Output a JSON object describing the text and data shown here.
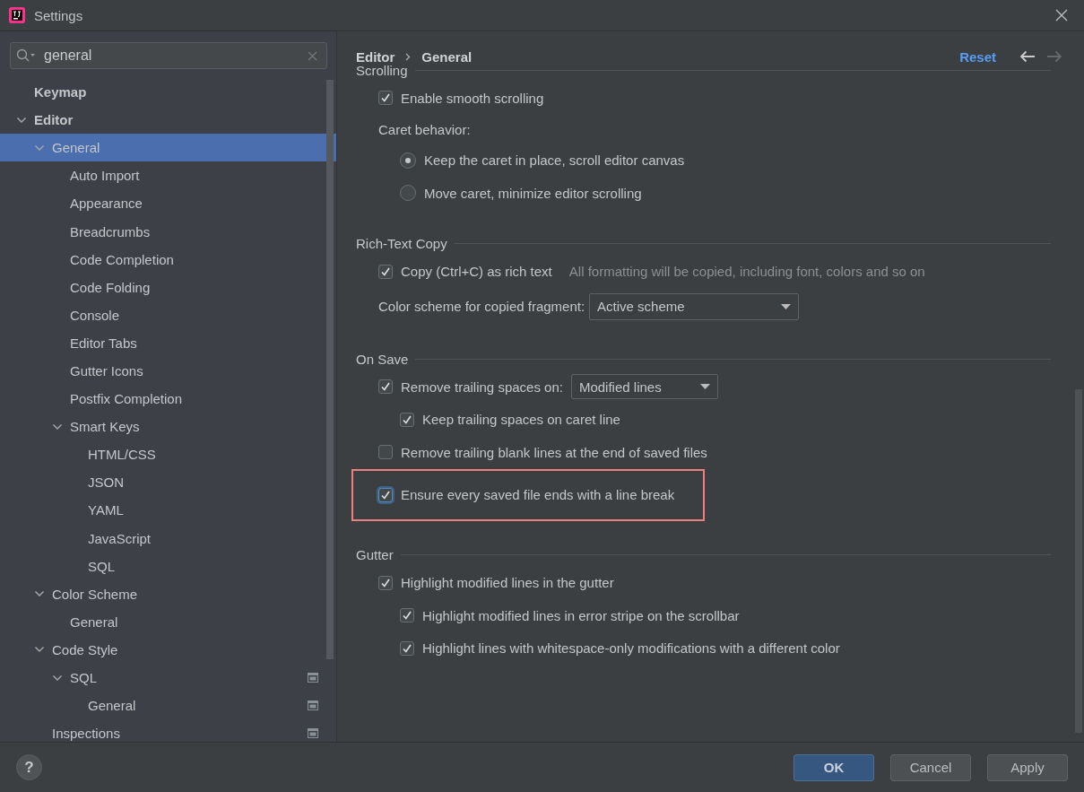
{
  "window": {
    "title": "Settings"
  },
  "search": {
    "value": "general"
  },
  "tree": [
    {
      "label": "Keymap",
      "selected": false
    },
    {
      "label": "Editor",
      "selected": false,
      "expanded": true,
      "children": [
        {
          "label": "General",
          "selected": true,
          "expanded": true,
          "children": [
            {
              "label": "Auto Import",
              "selected": false
            },
            {
              "label": "Appearance",
              "selected": false
            },
            {
              "label": "Breadcrumbs",
              "selected": false
            },
            {
              "label": "Code Completion",
              "selected": false
            },
            {
              "label": "Code Folding",
              "selected": false
            },
            {
              "label": "Console",
              "selected": false
            },
            {
              "label": "Editor Tabs",
              "selected": false
            },
            {
              "label": "Gutter Icons",
              "selected": false
            },
            {
              "label": "Postfix Completion",
              "selected": false
            },
            {
              "label": "Smart Keys",
              "selected": false,
              "expanded": true,
              "children": [
                {
                  "label": "HTML/CSS",
                  "selected": false
                },
                {
                  "label": "JSON",
                  "selected": false
                },
                {
                  "label": "YAML",
                  "selected": false
                },
                {
                  "label": "JavaScript",
                  "selected": false
                },
                {
                  "label": "SQL",
                  "selected": false
                }
              ]
            }
          ]
        },
        {
          "label": "Color Scheme",
          "selected": false,
          "expanded": true,
          "children": [
            {
              "label": "General",
              "selected": false
            }
          ]
        },
        {
          "label": "Code Style",
          "selected": false,
          "expanded": true,
          "children": [
            {
              "label": "SQL",
              "selected": false,
              "project_level": true,
              "expanded": true,
              "children": [
                {
                  "label": "General",
                  "selected": false,
                  "project_level": true
                }
              ]
            }
          ]
        },
        {
          "label": "Inspections",
          "selected": false,
          "project_level": true
        }
      ]
    }
  ],
  "breadcrumb": [
    "Editor",
    "General"
  ],
  "reset": "Reset",
  "forward_enabled": false,
  "sections": [
    {
      "title": "Scrolling",
      "items": [
        {
          "kind": "checkbox",
          "label": "Enable smooth scrolling",
          "checked": true
        },
        {
          "kind": "radio-group",
          "label": "Caret behavior:",
          "options": [
            {
              "label": "Keep the caret in place, scroll editor canvas",
              "selected": true
            },
            {
              "label": "Move caret, minimize editor scrolling",
              "selected": false
            }
          ]
        }
      ]
    },
    {
      "title": "Rich-Text Copy",
      "items": [
        {
          "kind": "checkbox",
          "label": "Copy (Ctrl+C) as rich text",
          "checked": true,
          "hint": "All formatting will be copied, including font, colors and so on"
        },
        {
          "kind": "dropdown",
          "label": "Color scheme for copied fragment:",
          "value": "Active scheme"
        }
      ]
    },
    {
      "title": "On Save",
      "items": [
        {
          "kind": "checkbox",
          "label": "Remove trailing spaces on:",
          "checked": true,
          "value": "Modified lines",
          "children": [
            {
              "kind": "checkbox",
              "label": "Keep trailing spaces on caret line",
              "checked": true
            }
          ]
        },
        {
          "kind": "checkbox",
          "label": "Remove trailing blank lines at the end of saved files",
          "checked": false
        },
        {
          "kind": "checkbox",
          "label": "Ensure every saved file ends with a line break",
          "checked": true,
          "focused": true,
          "highlighted": true
        }
      ]
    },
    {
      "title": "Gutter",
      "items": [
        {
          "kind": "checkbox",
          "label": "Highlight modified lines in the gutter",
          "checked": true,
          "children": [
            {
              "kind": "checkbox",
              "label": "Highlight modified lines in error stripe on the scrollbar",
              "checked": true
            },
            {
              "kind": "checkbox",
              "label": "Highlight lines with whitespace-only modifications with a different color",
              "checked": true
            }
          ]
        }
      ]
    }
  ],
  "help": "?",
  "buttons": [
    {
      "label": "OK",
      "default": true
    },
    {
      "label": "Cancel",
      "default": false
    },
    {
      "label": "Apply",
      "default": false
    }
  ]
}
